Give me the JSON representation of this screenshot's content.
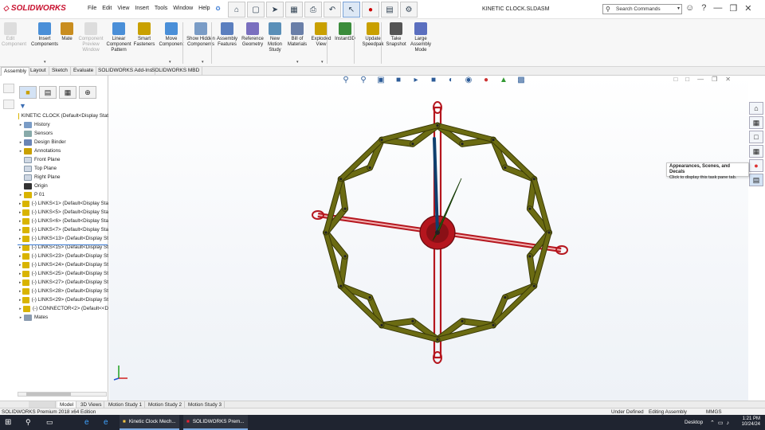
{
  "app": {
    "logo_text": "SOLIDWORKS",
    "doc_title": "KINETIC CLOCK.SLDASM"
  },
  "menu": [
    "File",
    "Edit",
    "View",
    "Insert",
    "Tools",
    "Window",
    "Help"
  ],
  "search": {
    "placeholder": "Search Commands"
  },
  "ribbon": [
    {
      "label": "Edit Component",
      "disabled": true
    },
    {
      "label": "Insert Components",
      "disabled": false
    },
    {
      "label": "Mate",
      "disabled": false
    },
    {
      "label": "Component Preview Window",
      "disabled": true
    },
    {
      "label": "Linear Component Pattern",
      "disabled": false
    },
    {
      "label": "Smart Fasteners",
      "disabled": false
    },
    {
      "label": "Move Component",
      "disabled": false
    },
    {
      "label": "Show Hidden Components",
      "disabled": false
    },
    {
      "label": "Assembly Features",
      "disabled": false
    },
    {
      "label": "Reference Geometry",
      "disabled": false
    },
    {
      "label": "New Motion Study",
      "disabled": false
    },
    {
      "label": "Bill of Materials",
      "disabled": false
    },
    {
      "label": "Exploded View",
      "disabled": false
    },
    {
      "label": "Instant3D",
      "disabled": false
    },
    {
      "label": "Update Speedpak",
      "disabled": false
    },
    {
      "label": "Take Snapshot",
      "disabled": false
    },
    {
      "label": "Large Assembly Mode",
      "disabled": false
    }
  ],
  "tabs": [
    "Assembly",
    "Layout",
    "Sketch",
    "Evaluate",
    "SOLIDWORKS Add-Ins",
    "SOLIDWORKS MBD"
  ],
  "tree": {
    "root": "KINETIC CLOCK  (Default<Display Stat",
    "items": [
      {
        "label": "History",
        "icon": "history-icon",
        "expandable": true
      },
      {
        "label": "Sensors",
        "icon": "sensor-icon",
        "expandable": false
      },
      {
        "label": "Design Binder",
        "icon": "binder-icon",
        "expandable": true
      },
      {
        "label": "Annotations",
        "icon": "annotation-icon",
        "expandable": true
      },
      {
        "label": "Front Plane",
        "icon": "plane-icon",
        "expandable": false
      },
      {
        "label": "Top Plane",
        "icon": "plane-icon",
        "expandable": false
      },
      {
        "label": "Right Plane",
        "icon": "plane-icon",
        "expandable": false
      },
      {
        "label": "Origin",
        "icon": "origin-icon",
        "expandable": false
      },
      {
        "label": "P 01",
        "icon": "part-icon",
        "expandable": true
      },
      {
        "label": "(-) LINKS<1> (Default<Display Sta",
        "icon": "part-icon",
        "expandable": true
      },
      {
        "label": "(-) LINKS<5> (Default<Display Sta",
        "icon": "part-icon",
        "expandable": true
      },
      {
        "label": "(-) LINKS<6> (Default<Display Sta",
        "icon": "part-icon",
        "expandable": true
      },
      {
        "label": "(-) LINKS<7> (Default<Display Sta",
        "icon": "part-icon",
        "expandable": true
      },
      {
        "label": "(-) LINKS<13> (Default<Display St",
        "icon": "part-icon",
        "expandable": true
      },
      {
        "label": "(-) LINKS<15> (Default<Display St",
        "icon": "part-icon",
        "expandable": true
      },
      {
        "label": "(-) LINKS<23> (Default<Display St",
        "icon": "part-icon",
        "expandable": true
      },
      {
        "label": "(-) LINKS<24> (Default<Display St",
        "icon": "part-icon",
        "expandable": true
      },
      {
        "label": "(-) LINKS<25> (Default<Display St",
        "icon": "part-icon",
        "expandable": true
      },
      {
        "label": "(-) LINKS<27> (Default<Display St",
        "icon": "part-icon",
        "expandable": true
      },
      {
        "label": "(-) LINKS<28> (Default<Display St",
        "icon": "part-icon",
        "expandable": true
      },
      {
        "label": "(-) LINKS<29> (Default<Display St",
        "icon": "part-icon",
        "expandable": true
      },
      {
        "label": "(-) CONNECTOR<2> (Default<<D",
        "icon": "part-icon",
        "expandable": true
      },
      {
        "label": "Mates",
        "icon": "mates-icon",
        "expandable": true
      }
    ]
  },
  "tooltip": {
    "title": "Appearances, Scenes, and Decals",
    "body": "Click to display this task pane tab."
  },
  "bottom_tabs": [
    "Model",
    "3D Views",
    "Motion Study 1",
    "Motion Study 2",
    "Motion Study 3"
  ],
  "status": {
    "edition": "SOLIDWORKS Premium 2018 x64 Edition",
    "state": "Under Defined",
    "mode": "Editing Assembly",
    "units": "MMGS"
  },
  "taskbar": {
    "app1": "Kinetic Clock Mech...",
    "app2": "SOLIDWORKS Prem...",
    "desktop": "Desktop",
    "time": "1:21 PM",
    "date": "10/24/24"
  },
  "colors": {
    "link_olive": "#6b6b12",
    "link_stroke": "#3a3a06",
    "frame_red": "#b5161e",
    "hand_green": "#2f5a12",
    "hand_blue": "#0e3f6e",
    "accent": "#3b7bd4"
  }
}
